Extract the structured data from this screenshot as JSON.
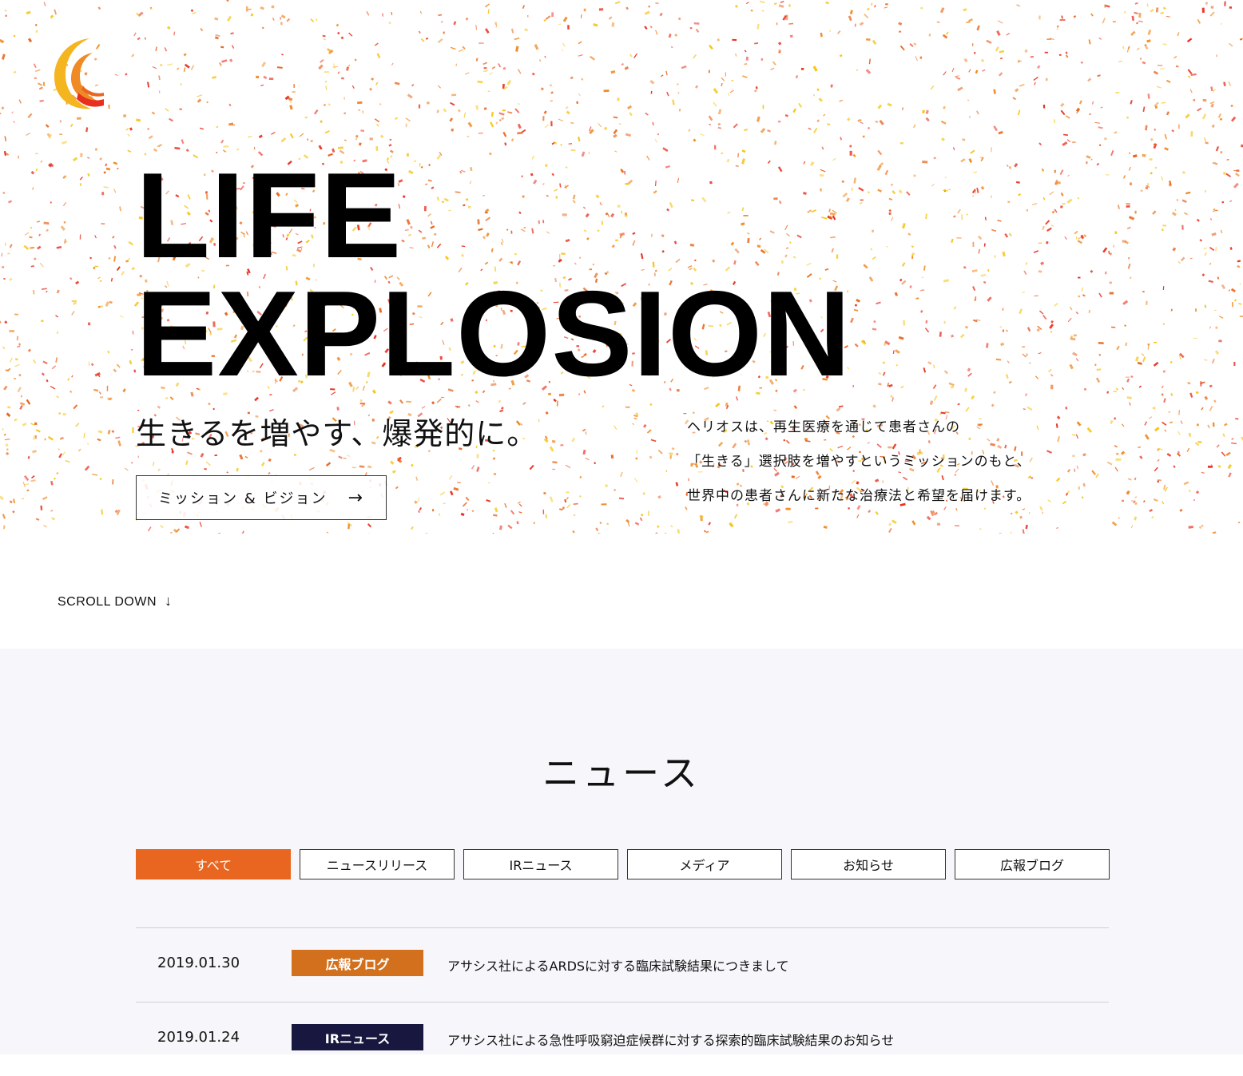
{
  "colors": {
    "accent_orange": "#e8661f",
    "pr_blog_badge": "#d2701d",
    "ir_news_badge": "#17173f",
    "confetti": [
      "#e8301f",
      "#f08a24",
      "#f5c518",
      "#e8661f"
    ]
  },
  "logo": {
    "icon": "crescent-logo-icon"
  },
  "hero": {
    "headline_line1": "LIFE",
    "headline_line2": "EXPLOSION",
    "tagline": "生きるを増やす、爆発的に。",
    "mission_button": {
      "label": "ミッション & ビジョン",
      "arrow": "→"
    },
    "description_lines": [
      "ヘリオスは、再生医療を通じて患者さんの",
      "「生きる」選択肢を増やすというミッションのもと、",
      "世界中の患者さんに新たな治療法と希望を届けます。"
    ]
  },
  "scroll": {
    "label": "SCROLL DOWN",
    "arrow": "↓"
  },
  "news": {
    "title": "ニュース",
    "tabs": [
      {
        "label": "すべて",
        "active": true
      },
      {
        "label": "ニュースリリース",
        "active": false
      },
      {
        "label": "IRニュース",
        "active": false
      },
      {
        "label": "メディア",
        "active": false
      },
      {
        "label": "お知らせ",
        "active": false
      },
      {
        "label": "広報ブログ",
        "active": false
      }
    ],
    "items": [
      {
        "date": "2019.01.30",
        "category": "広報ブログ",
        "title": "アサシス社によるARDSに対する臨床試験結果につきまして"
      },
      {
        "date": "2019.01.24",
        "category": "IRニュース",
        "title": "アサシス社による急性呼吸窮迫症候群に対する探索的臨床試験結果のお知らせ"
      }
    ]
  }
}
